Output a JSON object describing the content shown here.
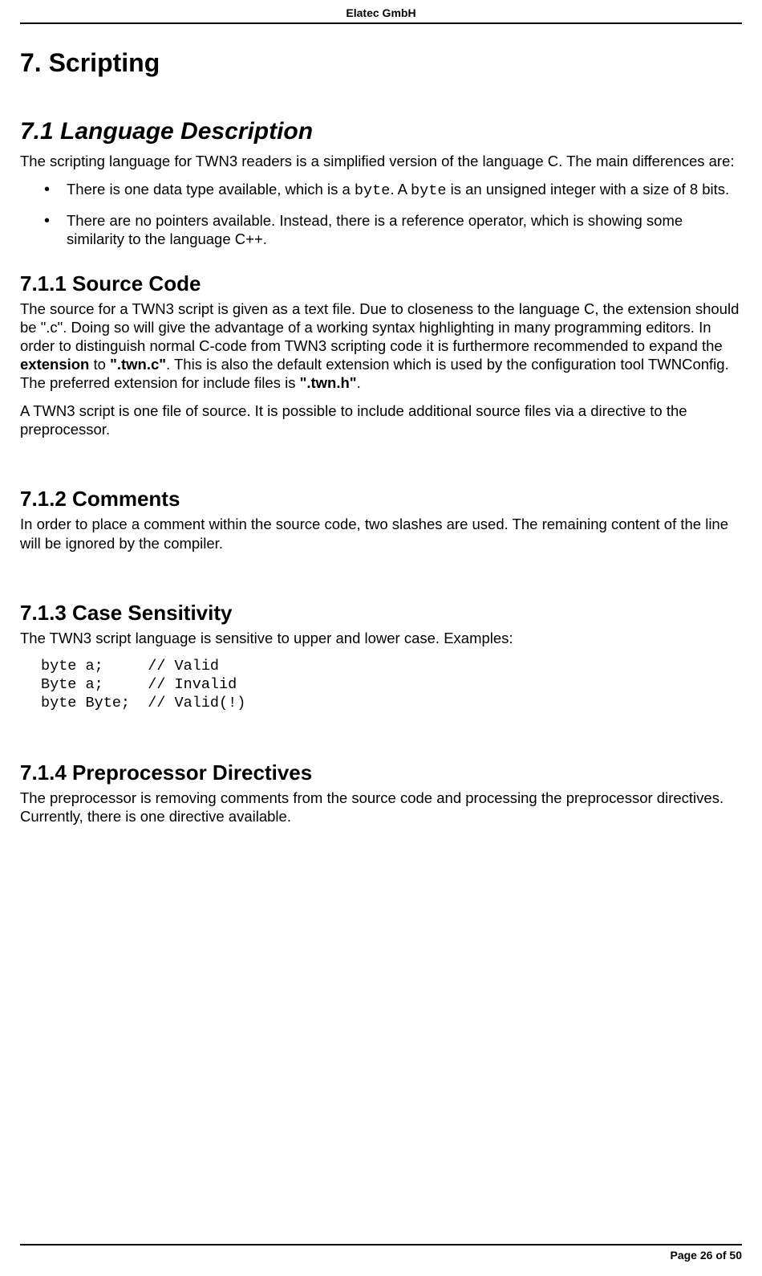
{
  "header": {
    "company": "Elatec GmbH"
  },
  "footer": {
    "page_label": "Page 26 of 50"
  },
  "h1": "7. Scripting",
  "section_71": {
    "title": "7.1  Language Description",
    "intro": "The scripting language for TWN3 readers is a simplified version of the language C. The main differences are:",
    "bullets": {
      "b1_pre": "There is one data type available, which is a ",
      "b1_code1": "byte",
      "b1_mid": ". A ",
      "b1_code2": "byte",
      "b1_post": " is an unsigned integer with a size of 8 bits.",
      "b2": "There are no pointers available. Instead, there is a reference operator, which is showing some similarity to the language C++."
    }
  },
  "section_711": {
    "title": "7.1.1  Source Code",
    "p1_a": "The source for a TWN3 script is given as a text file. Due to closeness to the language C, the extension should be \".c\". Doing so will give the advantage of a working syntax highlighting in many programming editors. In order to distinguish normal C-code from TWN3 scripting code it is furthermore recommended to expand the ",
    "p1_b_ext": "extension",
    "p1_c": " to ",
    "p1_b_twn_c": "\".twn.c\"",
    "p1_d": ". This is also the default extension which is used by the configuration tool TWNConfig. The preferred extension for include files is ",
    "p1_b_twn_h": "\".twn.h\"",
    "p1_e": ".",
    "p2": "A TWN3 script is one file of source. It is possible to include additional source files via a directive to the preprocessor."
  },
  "section_712": {
    "title": "7.1.2  Comments",
    "p1": "In order to place a comment within the source code, two slashes are used. The remaining content of the line will be ignored by the compiler."
  },
  "section_713": {
    "title": "7.1.3  Case Sensitivity",
    "p1": "The TWN3 script language is sensitive to upper and lower case. Examples:",
    "code": "byte a;     // Valid\nByte a;     // Invalid\nbyte Byte;  // Valid(!)"
  },
  "section_714": {
    "title": "7.1.4  Preprocessor Directives",
    "p1": "The preprocessor is removing comments from the source code and processing the preprocessor directives. Currently, there is one directive available."
  }
}
